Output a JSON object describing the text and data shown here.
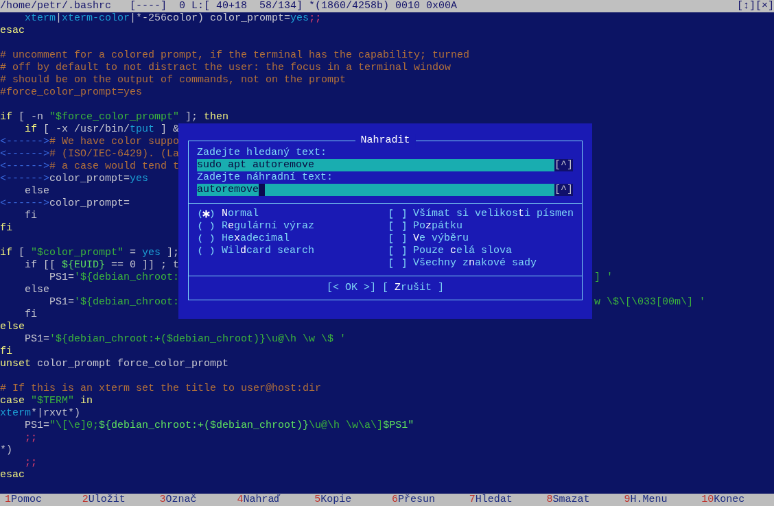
{
  "title_bar": {
    "text": "/home/petr/.bashrc   [----]  0 L:[ 40+18  58/134] *(1860/4258b) 0010 0x00A",
    "buttons": [
      "[↕]",
      "[×]"
    ]
  },
  "code_blocks": [
    [
      {
        "segs": [
          {
            "kind": "y",
            "text": "    xterm"
          },
          {
            "kind": "p",
            "text": "|"
          },
          {
            "kind": "y",
            "text": "xterm-color"
          },
          {
            "kind": "p",
            "text": "|*-256color) color_prompt="
          },
          {
            "kind": "y",
            "text": "yes"
          },
          {
            "kind": "r",
            "text": ";;"
          }
        ]
      },
      {
        "segs": [
          {
            "kind": "k",
            "text": "esac"
          }
        ]
      }
    ],
    [
      {
        "segs": [
          {
            "kind": "c",
            "text": "# uncomment for a colored prompt, if the terminal has the capability; turned"
          }
        ]
      },
      {
        "segs": [
          {
            "kind": "c",
            "text": "# off by default to not distract the user: the focus in a terminal window"
          }
        ]
      },
      {
        "segs": [
          {
            "kind": "c",
            "text": "# should be on the output of commands, not on the prompt"
          }
        ]
      },
      {
        "segs": [
          {
            "kind": "c",
            "text": "#force_color_prompt=yes"
          }
        ]
      }
    ],
    [
      {
        "segs": [
          {
            "kind": "k",
            "text": "if"
          },
          {
            "kind": "p",
            "text": " [ -n "
          },
          {
            "kind": "s",
            "text": "\"$force_color_prompt\""
          },
          {
            "kind": "p",
            "text": " ]; "
          },
          {
            "kind": "k",
            "text": "then"
          }
        ]
      },
      {
        "segs": [
          {
            "kind": "k",
            "text": "    if"
          },
          {
            "kind": "p",
            "text": " [ -x /usr/bin/"
          },
          {
            "kind": "y",
            "text": "tput"
          },
          {
            "kind": "p",
            "text": " ] &"
          }
        ]
      },
      {
        "segs": [
          {
            "kind": "t",
            "text": "<------>"
          },
          {
            "kind": "c",
            "text": "# We have color suppo"
          }
        ]
      },
      {
        "segs": [
          {
            "kind": "t",
            "text": "<------>"
          },
          {
            "kind": "c",
            "text": "# (ISO/IEC-6429). (La"
          }
        ]
      },
      {
        "segs": [
          {
            "kind": "t",
            "text": "<------>"
          },
          {
            "kind": "c",
            "text": "# a case would tend t"
          }
        ]
      },
      {
        "segs": [
          {
            "kind": "t",
            "text": "<------>"
          },
          {
            "kind": "p",
            "text": "color_prompt="
          },
          {
            "kind": "y",
            "text": "yes"
          }
        ]
      },
      {
        "segs": [
          {
            "kind": "p",
            "text": "    else"
          }
        ]
      },
      {
        "segs": [
          {
            "kind": "t",
            "text": "<------>"
          },
          {
            "kind": "p",
            "text": "color_prompt="
          }
        ]
      },
      {
        "segs": [
          {
            "kind": "p",
            "text": "    fi"
          }
        ]
      },
      {
        "segs": [
          {
            "kind": "k",
            "text": "fi"
          }
        ]
      }
    ],
    [
      {
        "segs": [
          {
            "kind": "k",
            "text": "if"
          },
          {
            "kind": "p",
            "text": " [ "
          },
          {
            "kind": "s",
            "text": "\"$color_prompt\""
          },
          {
            "kind": "p",
            "text": " = "
          },
          {
            "kind": "y",
            "text": "yes"
          },
          {
            "kind": "p",
            "text": " ];"
          }
        ]
      },
      {
        "segs": [
          {
            "kind": "p",
            "text": "    if [[ "
          },
          {
            "kind": "g",
            "text": "${EUID}"
          },
          {
            "kind": "p",
            "text": " == 0 ]] ; t"
          }
        ]
      },
      {
        "segs": [
          {
            "kind": "p",
            "text": "        PS1="
          },
          {
            "kind": "s",
            "text": "'${debian_chroot:"
          }
        ],
        "tail": [
          {
            "kind": "s",
            "text": "] '"
          }
        ]
      },
      {
        "segs": [
          {
            "kind": "p",
            "text": "    else"
          }
        ]
      },
      {
        "segs": [
          {
            "kind": "p",
            "text": "        PS1="
          },
          {
            "kind": "s",
            "text": "'${debian_chroot:"
          }
        ],
        "tail": [
          {
            "kind": "s",
            "text": "w \\$\\[\\033[00m\\] '"
          }
        ]
      },
      {
        "segs": [
          {
            "kind": "p",
            "text": "    fi"
          }
        ]
      },
      {
        "segs": [
          {
            "kind": "k",
            "text": "else"
          }
        ]
      },
      {
        "segs": [
          {
            "kind": "p",
            "text": "    PS1="
          },
          {
            "kind": "s",
            "text": "'${debian_chroot:+($debian_chroot)}\\u@\\h \\w \\$ '"
          }
        ]
      },
      {
        "segs": [
          {
            "kind": "k",
            "text": "fi"
          }
        ]
      },
      {
        "segs": [
          {
            "kind": "k",
            "text": "unset"
          },
          {
            "kind": "p",
            "text": " color_prompt force_color_prompt"
          }
        ]
      }
    ],
    [
      {
        "segs": [
          {
            "kind": "c",
            "text": "# If this is an xterm set the title to user@host:dir"
          }
        ]
      },
      {
        "segs": [
          {
            "kind": "k",
            "text": "case"
          },
          {
            "kind": "s",
            "text": " \"$TERM\" "
          },
          {
            "kind": "k",
            "text": "in"
          }
        ]
      },
      {
        "segs": [
          {
            "kind": "y",
            "text": "xterm"
          },
          {
            "kind": "p",
            "text": "*|rxvt*)"
          }
        ]
      },
      {
        "segs": [
          {
            "kind": "p",
            "text": "    PS1="
          },
          {
            "kind": "s",
            "text": "\"\\[\\e]0;"
          },
          {
            "kind": "g",
            "text": "${debian_chroot:+($debian_chroot)}"
          },
          {
            "kind": "s",
            "text": "\\u@\\h \\w\\a\\]"
          },
          {
            "kind": "g",
            "text": "$PS1\""
          }
        ]
      },
      {
        "segs": [
          {
            "kind": "r",
            "text": "    ;;"
          }
        ]
      },
      {
        "segs": [
          {
            "kind": "p",
            "text": "*)"
          }
        ]
      },
      {
        "segs": [
          {
            "kind": "r",
            "text": "    ;;"
          }
        ]
      },
      {
        "segs": [
          {
            "kind": "k",
            "text": "esac"
          }
        ]
      }
    ]
  ],
  "dialog": {
    "title": "Nahradit",
    "fields": [
      {
        "label": "Zadejte hledaný text:",
        "value": "sudo apt autoremove",
        "history": "[^]",
        "focused": false
      },
      {
        "label": "Zadejte náhradní text:",
        "value": "autoremove",
        "history": "[^]",
        "focused": true
      }
    ],
    "modes": [
      {
        "hotkey": "N",
        "after": "ormal",
        "selected": true
      },
      {
        "before": "R",
        "hotkey": "e",
        "after": "gulární výraz",
        "selected": false
      },
      {
        "before": "He",
        "hotkey": "x",
        "after": "adecimal",
        "selected": false
      },
      {
        "before": "Wil",
        "hotkey": "d",
        "after": "card search",
        "selected": false
      }
    ],
    "options": [
      {
        "before": "Všímat si velikos",
        "hotkey": "t",
        "after": "i písmen",
        "checked": false
      },
      {
        "before": "Po",
        "hotkey": "z",
        "after": "pátku",
        "checked": false
      },
      {
        "hotkey": "V",
        "after": "e výběru",
        "checked": false
      },
      {
        "before": "Pouze ",
        "hotkey": "c",
        "after": "elá slova",
        "checked": false
      },
      {
        "before": "Všechny z",
        "hotkey": "n",
        "after": "akové sady",
        "checked": false
      }
    ],
    "buttons": [
      {
        "kind": "default",
        "before": "[< ",
        "hotkey": "O",
        "after": "K >]"
      },
      {
        "kind": "normal",
        "before": "[ ",
        "hotkey": "Z",
        "after": "rušit ]"
      }
    ]
  },
  "function_keys": [
    {
      "key": "1",
      "label": "Pomoc"
    },
    {
      "key": "2",
      "label": "Uložit"
    },
    {
      "key": "3",
      "label": "Označ"
    },
    {
      "key": "4",
      "label": "Nahraď"
    },
    {
      "key": "5",
      "label": "Kopie"
    },
    {
      "key": "6",
      "label": "Přesun"
    },
    {
      "key": "7",
      "label": "Hledat"
    },
    {
      "key": "8",
      "label": "Smazat"
    },
    {
      "key": "9",
      "label": "H.Menu"
    },
    {
      "key": "10",
      "label": "Konec"
    }
  ]
}
